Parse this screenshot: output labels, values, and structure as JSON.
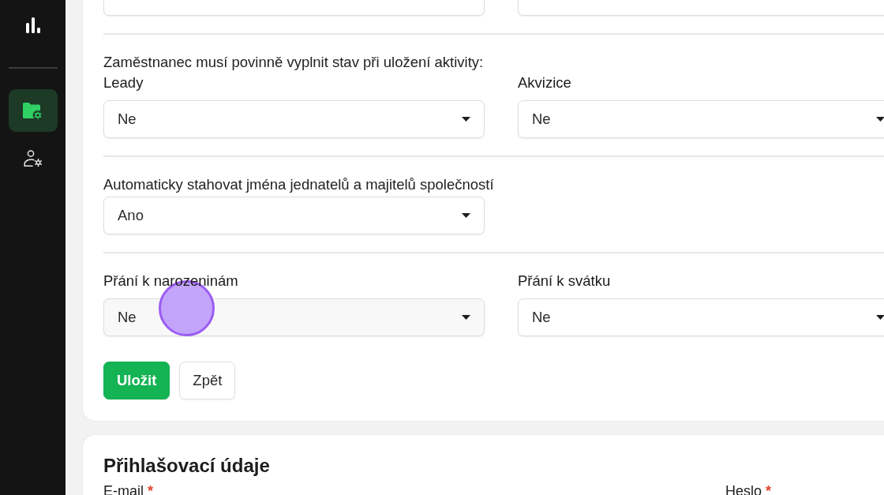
{
  "sidebar": {
    "items": [
      {
        "kind": "folder-settings",
        "selected": true
      },
      {
        "kind": "user-settings",
        "selected": false
      }
    ]
  },
  "settings_card": {
    "sections": [
      {
        "fields": [
          {
            "hovered": false
          },
          {
            "hovered": false
          }
        ]
      },
      {
        "note": "Zaměstnanec musí povinně vyplnit stav při uložení aktivity:",
        "fields": [
          {
            "label": "Leady",
            "value": "Ne",
            "hovered": false
          },
          {
            "label": "Akvizice",
            "value": "Ne",
            "hovered": false
          }
        ]
      },
      {
        "note": "Automaticky stahovat jména jednatelů a majitelů společností",
        "fields": [
          {
            "value": "Ano",
            "hovered": false
          }
        ]
      },
      {
        "fields": [
          {
            "label": "Přání k narozeninám",
            "value": "Ne",
            "hovered": true
          },
          {
            "label": "Přání k svátku",
            "value": "Ne",
            "hovered": false
          }
        ]
      }
    ],
    "buttons": [
      {
        "label": "Uložit",
        "kind": "primary"
      },
      {
        "label": "Zpět",
        "kind": "secondary"
      }
    ]
  },
  "login_card": {
    "title": "Přihlašovací údaje",
    "fields": [
      {
        "label": "E-mail",
        "required_mark": "*"
      },
      {
        "label": "Heslo",
        "required_mark": "*"
      }
    ]
  }
}
